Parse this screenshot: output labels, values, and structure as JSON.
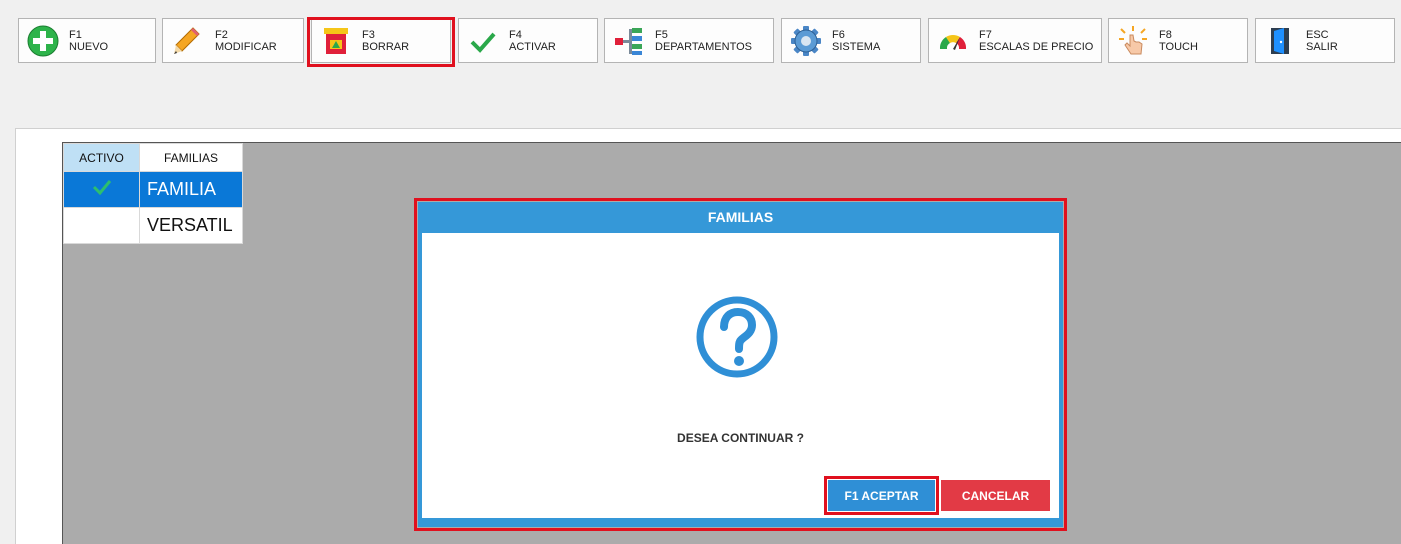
{
  "toolbar": {
    "nuevo": {
      "key": "F1",
      "label": "NUEVO"
    },
    "modificar": {
      "key": "F2",
      "label": "MODIFICAR"
    },
    "borrar": {
      "key": "F3",
      "label": "BORRAR"
    },
    "activar": {
      "key": "F4",
      "label": "ACTIVAR"
    },
    "departamentos": {
      "key": "F5",
      "label": "DEPARTAMENTOS"
    },
    "sistema": {
      "key": "F6",
      "label": "SISTEMA"
    },
    "escalas": {
      "key": "F7",
      "label": "ESCALAS DE PRECIO"
    },
    "touch": {
      "key": "F8",
      "label": "TOUCH"
    },
    "salir": {
      "key": "ESC",
      "label": "SALIR"
    }
  },
  "grid": {
    "columns": [
      "ACTIVO",
      "FAMILIAS"
    ],
    "rows": [
      {
        "activo": true,
        "name": "FAMILIA",
        "selected": true
      },
      {
        "activo": false,
        "name": "VERSATIL",
        "selected": false
      }
    ]
  },
  "dialog": {
    "title": "FAMILIAS",
    "message": "DESEA CONTINUAR ?",
    "accept_label": "F1 ACEPTAR",
    "cancel_label": "CANCELAR"
  },
  "icons": {
    "nuevo": "plus-circle-icon",
    "modificar": "pencil-icon",
    "borrar": "trash-bin-icon",
    "activar": "checkmark-icon",
    "departamentos": "hierarchy-icon",
    "sistema": "gear-icon",
    "escalas": "gauge-icon",
    "touch": "touch-hand-icon",
    "salir": "exit-door-icon",
    "dialog": "question-circle-icon"
  },
  "colors": {
    "accent_blue": "#3598d8",
    "selected_row": "#0a78d7",
    "highlight_red": "#e0101e",
    "cancel_red": "#e23a45",
    "check_green": "#2dbf6e"
  }
}
